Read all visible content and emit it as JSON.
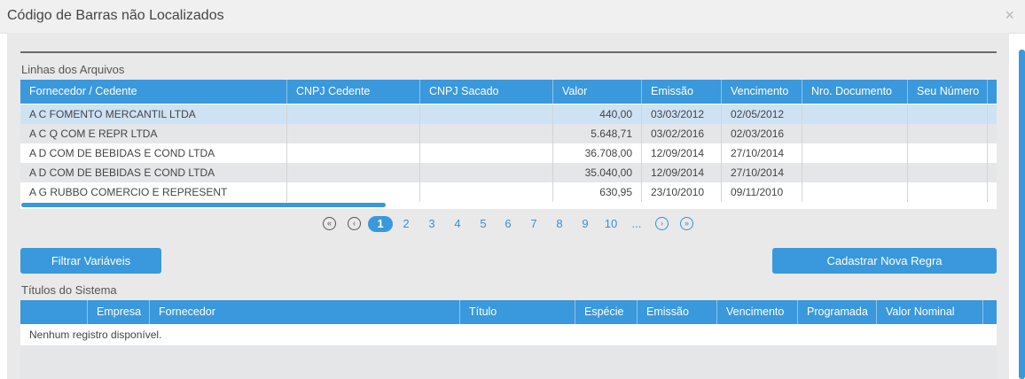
{
  "dialog": {
    "title": "Código de Barras não Localizados",
    "close_label": "×"
  },
  "arquivos": {
    "section_title": "Linhas dos Arquivos",
    "columns": [
      "Fornecedor / Cedente",
      "CNPJ Cedente",
      "CNPJ Sacado",
      "Valor",
      "Emissão",
      "Vencimento",
      "Nro. Documento",
      "Seu Número"
    ],
    "rows": [
      {
        "fornecedor": "A C FOMENTO MERCANTIL LTDA",
        "cnpj_cedente": "",
        "cnpj_sacado": "",
        "valor": "440,00",
        "emissao": "03/03/2012",
        "vencimento": "02/05/2012",
        "nro_documento": "",
        "seu_numero": "",
        "selected": true
      },
      {
        "fornecedor": "A C Q COM E REPR LTDA",
        "cnpj_cedente": "",
        "cnpj_sacado": "",
        "valor": "5.648,71",
        "emissao": "03/02/2016",
        "vencimento": "02/03/2016",
        "nro_documento": "",
        "seu_numero": ""
      },
      {
        "fornecedor": "A D COM DE BEBIDAS E COND LTDA",
        "cnpj_cedente": "",
        "cnpj_sacado": "",
        "valor": "36.708,00",
        "emissao": "12/09/2014",
        "vencimento": "27/10/2014",
        "nro_documento": "",
        "seu_numero": ""
      },
      {
        "fornecedor": "A D COM DE BEBIDAS E COND LTDA",
        "cnpj_cedente": "",
        "cnpj_sacado": "",
        "valor": "35.040,00",
        "emissao": "12/09/2014",
        "vencimento": "27/10/2014",
        "nro_documento": "",
        "seu_numero": ""
      },
      {
        "fornecedor": "A G RUBBO COMERCIO E REPRESENT",
        "cnpj_cedente": "",
        "cnpj_sacado": "",
        "valor": "630,95",
        "emissao": "23/10/2010",
        "vencimento": "09/11/2010",
        "nro_documento": "",
        "seu_numero": ""
      }
    ]
  },
  "pagination": {
    "first_icon": "double-chevron-left-icon",
    "prev_icon": "chevron-left-icon",
    "pages": [
      "1",
      "2",
      "3",
      "4",
      "5",
      "6",
      "7",
      "8",
      "9",
      "10",
      "..."
    ],
    "current": "1",
    "next_icon": "chevron-right-icon",
    "last_icon": "double-chevron-right-icon"
  },
  "actions": {
    "filtrar_label": "Filtrar Variáveis",
    "cadastrar_label": "Cadastrar Nova Regra"
  },
  "titulos": {
    "section_title": "Títulos do Sistema",
    "columns": [
      "",
      "Empresa",
      "Fornecedor",
      "Título",
      "Espécie",
      "Emissão",
      "Vencimento",
      "Programada",
      "Valor Nominal"
    ],
    "empty_message": "Nenhum registro disponível."
  },
  "colors": {
    "accent": "#3a98dc",
    "selected_row": "#cde3f4",
    "alt_row": "#e5e6e8"
  }
}
